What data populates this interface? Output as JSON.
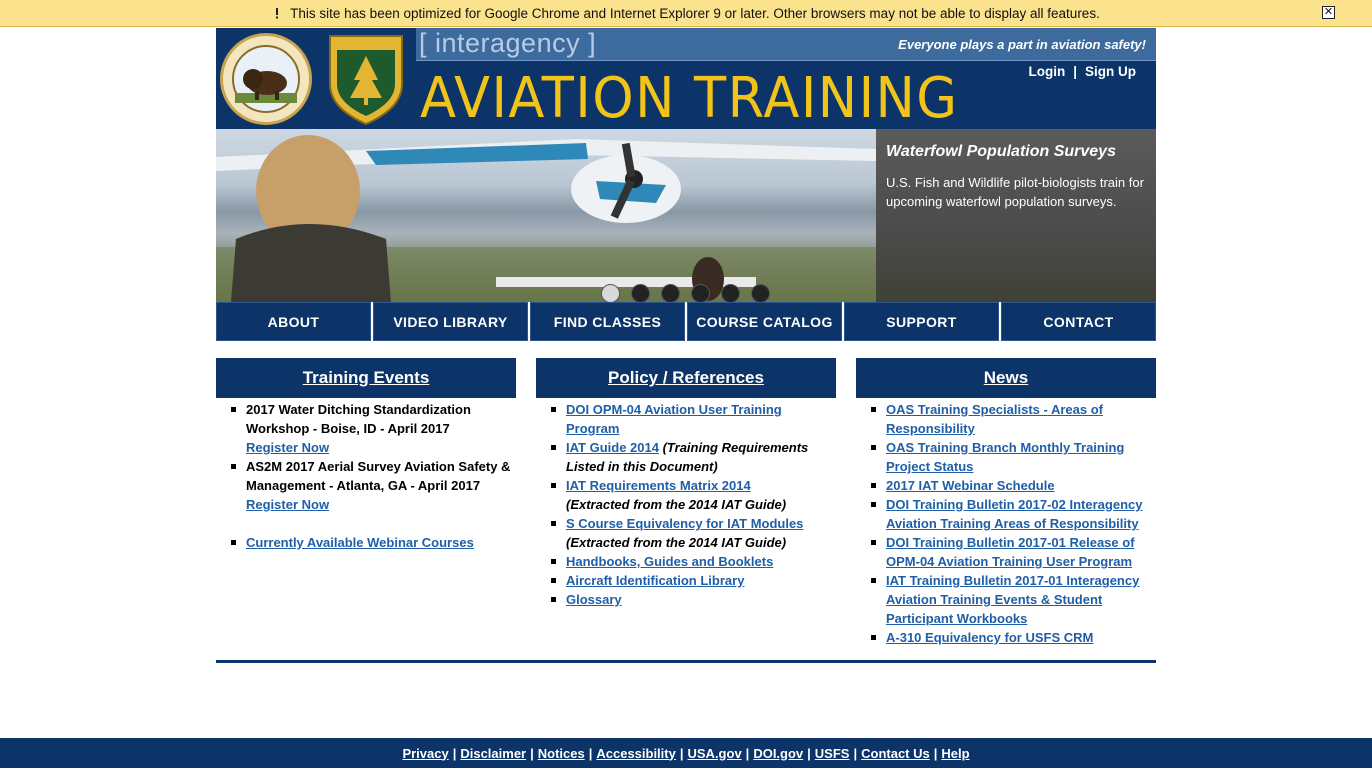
{
  "notice": {
    "text": "This site has been optimized for Google Chrome and Internet Explorer 9 or later. Other browsers may not be able to display all features.",
    "close_symbol": "✕"
  },
  "header": {
    "interagency": "[ interagency ]",
    "tagline": "Everyone plays a part in aviation safety!",
    "title": "AVIATION TRAINING",
    "login": "Login",
    "separator": "|",
    "signup": "Sign Up",
    "seal_doi_label": "U.S. DEPARTMENT OF THE INTERIOR · MARCH 3, 1849",
    "seal_usfs_label": "FOREST SERVICE · DEPARTMENT OF AGRICULTURE"
  },
  "hero": {
    "caption_title": "Waterfowl Population Surveys",
    "caption_text": "U.S. Fish and Wildlife pilot-biologists train for upcoming waterfowl population surveys.",
    "slide_count": 6,
    "active_slide": 1
  },
  "nav": [
    "ABOUT",
    "VIDEO LIBRARY",
    "FIND CLASSES",
    "COURSE CATALOG",
    "SUPPORT",
    "CONTACT"
  ],
  "training": {
    "title": "Training Events",
    "events": [
      {
        "text": "2017 Water Ditching Standardization Workshop - Boise, ID - April 2017",
        "link": "Register Now"
      },
      {
        "text": "AS2M 2017 Aerial Survey Aviation Safety & Management - Atlanta, GA - April 2017",
        "link": "Register Now"
      }
    ],
    "webinar": "Currently Available Webinar Courses"
  },
  "policy": {
    "title": "Policy / References",
    "items": [
      {
        "link": "DOI OPM-04 Aviation User Training Program",
        "note": ""
      },
      {
        "link": "IAT Guide 2014",
        "note": "(Training Requirements Listed in this Document)"
      },
      {
        "link": "IAT Requirements Matrix 2014",
        "note": "(Extracted from the 2014 IAT Guide)"
      },
      {
        "link": "S Course Equivalency for IAT Modules",
        "note": "(Extracted from the 2014 IAT Guide)"
      },
      {
        "link": "Handbooks, Guides and Booklets",
        "note": ""
      },
      {
        "link": "Aircraft Identification Library",
        "note": ""
      },
      {
        "link": "Glossary",
        "note": ""
      }
    ]
  },
  "news": {
    "title": "News",
    "items": [
      "OAS Training Specialists - Areas of Responsibility",
      "OAS Training Branch Monthly Training Project Status",
      "2017 IAT Webinar Schedule",
      "DOI Training Bulletin 2017-02 Interagency Aviation Training Areas of Responsibility",
      "DOI Training Bulletin 2017-01 Release of OPM-04 Aviation Training User Program",
      "IAT Training Bulletin 2017-01 Interagency Aviation Training Events & Student Participant Workbooks",
      "A-310 Equivalency for USFS CRM"
    ]
  },
  "footer": [
    "Privacy",
    "Disclaimer",
    "Notices",
    "Accessibility",
    "USA.gov",
    "DOI.gov",
    "USFS",
    "Contact Us",
    "Help"
  ],
  "colors": {
    "navy": "#0c3468",
    "gold": "#f2c419",
    "link": "#1f5fa8",
    "notice": "#fbe38e"
  }
}
